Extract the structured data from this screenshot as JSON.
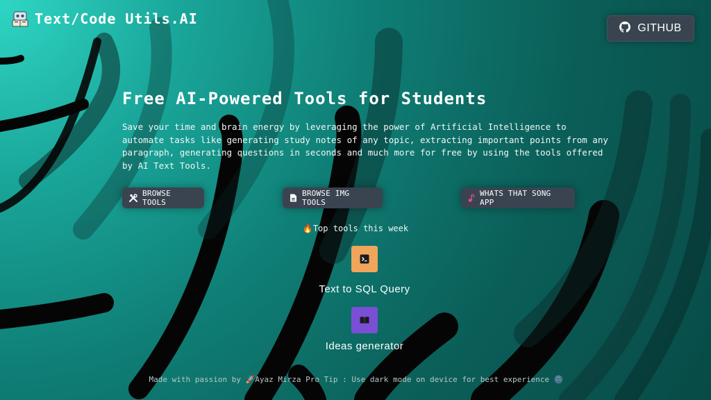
{
  "brand": {
    "title": "Text/Code Utils.AI",
    "logo_icon": "robot-reading-icon"
  },
  "header": {
    "github_label": "GITHUB",
    "github_icon": "github-icon"
  },
  "hero": {
    "title": "Free AI-Powered Tools for Students",
    "description": "Save your time and brain energy by leveraging the power of Artificial Intelligence to automate tasks like generating study notes of any topic, extracting important points from any paragraph, generating questions in seconds and much more for free by using the tools offered by AI Text Tools."
  },
  "actions": {
    "browse_tools": "BROWSE TOOLS",
    "browse_img_tools": "BROWSE IMG TOOLS",
    "song_app": "WHATS THAT SONG APP"
  },
  "top_tools": {
    "heading": "🔥Top tools this week",
    "items": [
      {
        "label": "Text to SQL Query",
        "icon": "terminal-icon",
        "color": "#f0a55c"
      },
      {
        "label": "Ideas generator",
        "icon": "book-open-icon",
        "color": "#7a4fd6"
      }
    ]
  },
  "footer": {
    "text": "Made with passion by 🚀Ayaz Mirza Pro Tip : Use dark mode on device for best experience 🌚"
  },
  "colors": {
    "button_bg": "#3a4450",
    "accent_teal": "#1aa69a"
  }
}
